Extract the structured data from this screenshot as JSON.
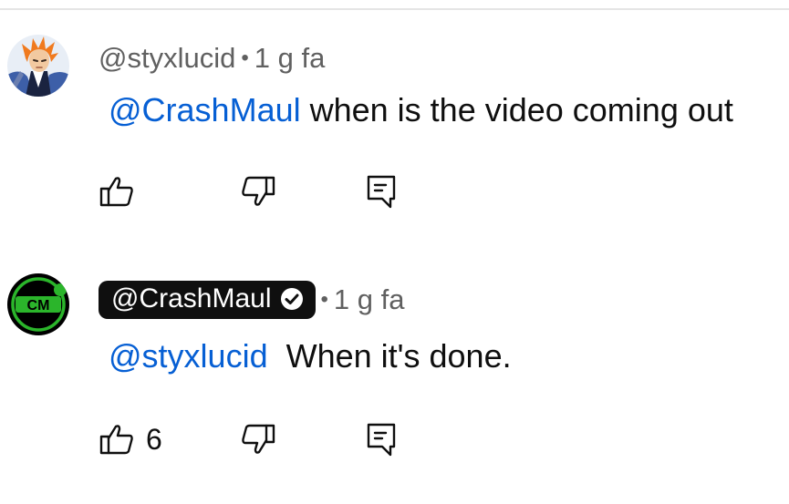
{
  "comments": [
    {
      "author": "@styxlucid",
      "separator": "•",
      "time": "1 g fa",
      "mention": "@CrashMaul",
      "text": " when is the video coming out",
      "like_count": "",
      "avatar_icon": "anime-character-avatar"
    },
    {
      "author": "@CrashMaul",
      "separator": "•",
      "time": "1 g fa",
      "mention": "@styxlucid",
      "text": "  When it's done.",
      "like_count": "6",
      "avatar_icon": "cm-logo-avatar",
      "author_verified": true
    }
  ],
  "icons": {
    "like": "thumbs-up-icon",
    "dislike": "thumbs-down-icon",
    "reply": "reply-comment-icon",
    "verified": "verified-check-icon"
  },
  "colors": {
    "mention": "#065fd4",
    "meta": "#606060",
    "text": "#0f0f0f",
    "pill_bg": "#0f0f0f",
    "logo_green": "#2bb52b"
  }
}
